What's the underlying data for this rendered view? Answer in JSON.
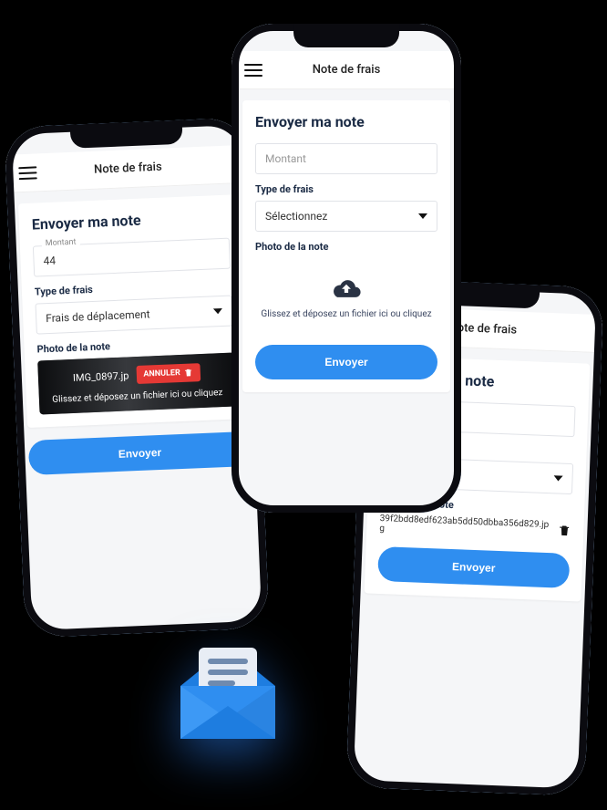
{
  "app_title": "Note de frais",
  "form_title": "Envoyer ma note",
  "amount_label": "Montant",
  "type_label": "Type de frais",
  "photo_label": "Photo de la note",
  "upload_hint": "Glissez et déposez un fichier ici ou cliquez",
  "select_placeholder": "Sélectionnez",
  "send_label": "Envoyer",
  "cancel_label": "ANNULER",
  "phone1": {
    "amount_value": "44",
    "type_value": "Frais de déplacement",
    "file_name": "IMG_0897.jp"
  },
  "phone2": {
    "amount_value": "",
    "type_value": "Sélectionnez"
  },
  "phone3": {
    "file_name": "39f2bdd8edf623ab5dd50dbba356d829.jpg"
  }
}
